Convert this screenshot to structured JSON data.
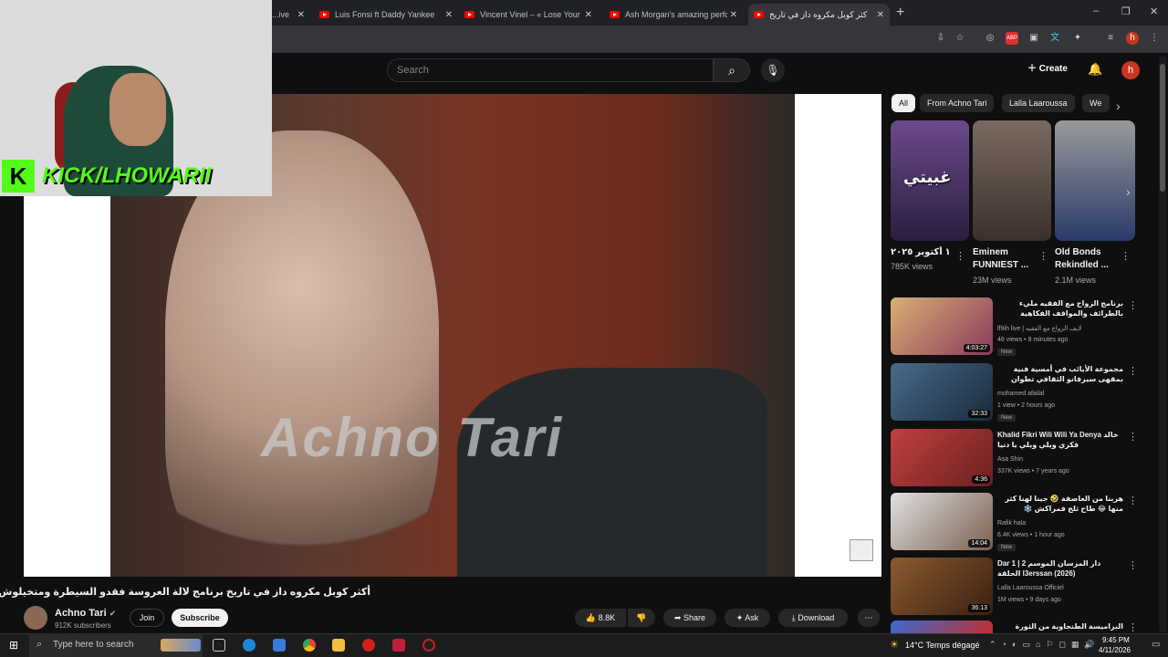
{
  "browser": {
    "tabs": [
      {
        "label": "...ive o"
      },
      {
        "label": "Luis Fonsi ft Daddy Yankee – De"
      },
      {
        "label": "Vincent Vinel – « Lose Yourself"
      },
      {
        "label": "Ash Morgan's amazing perform"
      },
      {
        "label": "أكثر كوبل مكروه داز في تاريخ"
      }
    ],
    "new_tab": "+",
    "win_min": "–",
    "win_max": "❐",
    "win_close": "✕"
  },
  "youtube": {
    "search_placeholder": "Search",
    "create_label": "Create",
    "avatar_letter": "h"
  },
  "overlay": {
    "kick_letter": "K",
    "kick_text": "KICK/LHOWARII"
  },
  "video": {
    "watermark": "Achno Tari",
    "title": "أكثر كوبل مكروه داز في تاريخ برنامج لالة العروسة فقدو السيطرة ومتخيلوش أشنو دارو",
    "channel": "Achno Tari",
    "subscribers": "912K subscribers",
    "join": "Join",
    "subscribe": "Subscribe",
    "likes": "8.8K",
    "share": "Share",
    "ask": "Ask",
    "download": "Download"
  },
  "chips": [
    "All",
    "From Achno Tari",
    "Lalla Laaroussa",
    "We"
  ],
  "shorts": [
    {
      "title": "١ أكتوبر ٢٠٢٥",
      "views": "785K views",
      "overlay": "غبيتي"
    },
    {
      "title": "Eminem FUNNIEST ...",
      "views": "23M views"
    },
    {
      "title": "Old Bonds Rekindled ...",
      "views": "2.1M views"
    }
  ],
  "recommendations": [
    {
      "title": "برنامج الزواج مع الفقيه مليء بالطرائف والمواقف الفكاهية",
      "channel": "lf9ih live | لايف الزواج مع الفقيه",
      "meta": "48 views • 8 minutes ago",
      "duration": "4:03:27",
      "badge": "New"
    },
    {
      "title": "مجموعة الأيائب في أمسية فنية بمقهى سيرفانو الثقافي تطوان",
      "channel": "mohamed afailal",
      "meta": "1 view • 2 hours ago",
      "duration": "32:33",
      "badge": "New"
    },
    {
      "title": "Khalid Fikri Wili Wili Ya Denya خالد فكري ويلي ويلي يا دنيا",
      "channel": "Asa Shin",
      "meta": "337K views • 7 years ago",
      "duration": "4:36",
      "badge": ""
    },
    {
      "title": "هربنا من العاصفة 🤣 جينا لهنا كثر منها 😂 طاح ثلج فمراكش ❄️",
      "channel": "Rafik hala",
      "meta": "6.4K views • 1 hour ago",
      "duration": "14:04",
      "badge": "New"
    },
    {
      "title": "Dar 1 دار المرسان الموسم 2 | الحلقة l3erssan (2026)",
      "channel": "Lalla Laaroussa Officiel",
      "meta": "1M views • 9 days ago",
      "duration": "36:13",
      "badge": ""
    },
    {
      "title": "البراميسة الطنجاوية من الثورة فالتيك توك",
      "channel": "",
      "meta": "",
      "duration": "",
      "badge": ""
    }
  ],
  "taskbar": {
    "search_placeholder": "Type here to search",
    "weather": "14°C  Temps dégagé",
    "time": "9:45 PM",
    "date": "4/11/2026"
  },
  "colors": {
    "bg": "#0f0f0f",
    "kick_green": "#53fc18",
    "yt_red": "#ff0000"
  }
}
